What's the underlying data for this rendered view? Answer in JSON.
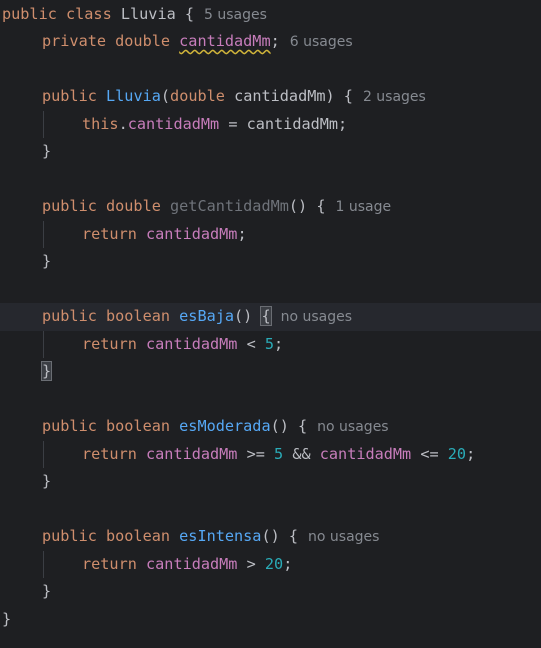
{
  "editor": {
    "language": "Java",
    "lines": [
      {
        "indent": 0,
        "tokens": [
          {
            "t": "public class ",
            "c": "kw"
          },
          {
            "t": "Lluvia {",
            "c": ""
          }
        ],
        "hint": "5 usages"
      },
      {
        "indent": 1,
        "tokens": [
          {
            "t": "private double ",
            "c": "kw"
          },
          {
            "t": "cantidadMm",
            "c": "fld warn"
          },
          {
            "t": ";",
            "c": ""
          }
        ],
        "hint": "6 usages"
      },
      {
        "indent": 0,
        "tokens": []
      },
      {
        "indent": 1,
        "tokens": [
          {
            "t": "public ",
            "c": "kw"
          },
          {
            "t": "Lluvia",
            "c": "ctor"
          },
          {
            "t": "(",
            "c": ""
          },
          {
            "t": "double ",
            "c": "kw"
          },
          {
            "t": "cantidadMm) {",
            "c": ""
          }
        ],
        "hint": "2 usages"
      },
      {
        "indent": 2,
        "tokens": [
          {
            "t": "this",
            "c": "kw"
          },
          {
            "t": ".",
            "c": ""
          },
          {
            "t": "cantidadMm",
            "c": "fld"
          },
          {
            "t": " = cantidadMm;",
            "c": ""
          }
        ]
      },
      {
        "indent": 1,
        "tokens": [
          {
            "t": "}",
            "c": ""
          }
        ]
      },
      {
        "indent": 0,
        "tokens": []
      },
      {
        "indent": 1,
        "tokens": [
          {
            "t": "public double ",
            "c": "kw"
          },
          {
            "t": "getCantidadMm",
            "c": "dim"
          },
          {
            "t": "() {",
            "c": ""
          }
        ],
        "hint": "1 usage"
      },
      {
        "indent": 2,
        "tokens": [
          {
            "t": "return ",
            "c": "kw"
          },
          {
            "t": "cantidadMm",
            "c": "fld"
          },
          {
            "t": ";",
            "c": ""
          }
        ]
      },
      {
        "indent": 1,
        "tokens": [
          {
            "t": "}",
            "c": ""
          }
        ]
      },
      {
        "indent": 0,
        "tokens": []
      },
      {
        "indent": 1,
        "current": true,
        "tokens": [
          {
            "t": "public boolean ",
            "c": "kw"
          },
          {
            "t": "esBaja",
            "c": "fn"
          },
          {
            "t": "() ",
            "c": ""
          },
          {
            "t": "{",
            "c": "match"
          }
        ],
        "hint": "no usages"
      },
      {
        "indent": 2,
        "tokens": [
          {
            "t": "return ",
            "c": "kw"
          },
          {
            "t": "cantidadMm",
            "c": "fld"
          },
          {
            "t": " < ",
            "c": ""
          },
          {
            "t": "5",
            "c": "num"
          },
          {
            "t": ";",
            "c": ""
          }
        ]
      },
      {
        "indent": 1,
        "tokens": [
          {
            "t": "}",
            "c": "match"
          }
        ]
      },
      {
        "indent": 0,
        "tokens": []
      },
      {
        "indent": 1,
        "tokens": [
          {
            "t": "public boolean ",
            "c": "kw"
          },
          {
            "t": "esModerada",
            "c": "fn"
          },
          {
            "t": "() {",
            "c": ""
          }
        ],
        "hint": "no usages"
      },
      {
        "indent": 2,
        "tokens": [
          {
            "t": "return ",
            "c": "kw"
          },
          {
            "t": "cantidadMm",
            "c": "fld"
          },
          {
            "t": " >= ",
            "c": ""
          },
          {
            "t": "5",
            "c": "num"
          },
          {
            "t": " && ",
            "c": ""
          },
          {
            "t": "cantidadMm",
            "c": "fld"
          },
          {
            "t": " <= ",
            "c": ""
          },
          {
            "t": "20",
            "c": "num"
          },
          {
            "t": ";",
            "c": ""
          }
        ]
      },
      {
        "indent": 1,
        "tokens": [
          {
            "t": "}",
            "c": ""
          }
        ]
      },
      {
        "indent": 0,
        "tokens": []
      },
      {
        "indent": 1,
        "tokens": [
          {
            "t": "public boolean ",
            "c": "kw"
          },
          {
            "t": "esIntensa",
            "c": "fn"
          },
          {
            "t": "() {",
            "c": ""
          }
        ],
        "hint": "no usages"
      },
      {
        "indent": 2,
        "tokens": [
          {
            "t": "return ",
            "c": "kw"
          },
          {
            "t": "cantidadMm",
            "c": "fld"
          },
          {
            "t": " > ",
            "c": ""
          },
          {
            "t": "20",
            "c": "num"
          },
          {
            "t": ";",
            "c": ""
          }
        ]
      },
      {
        "indent": 1,
        "tokens": [
          {
            "t": "}",
            "c": ""
          }
        ]
      },
      {
        "indent": 0,
        "tokens": [
          {
            "t": "}",
            "c": ""
          }
        ]
      }
    ]
  }
}
